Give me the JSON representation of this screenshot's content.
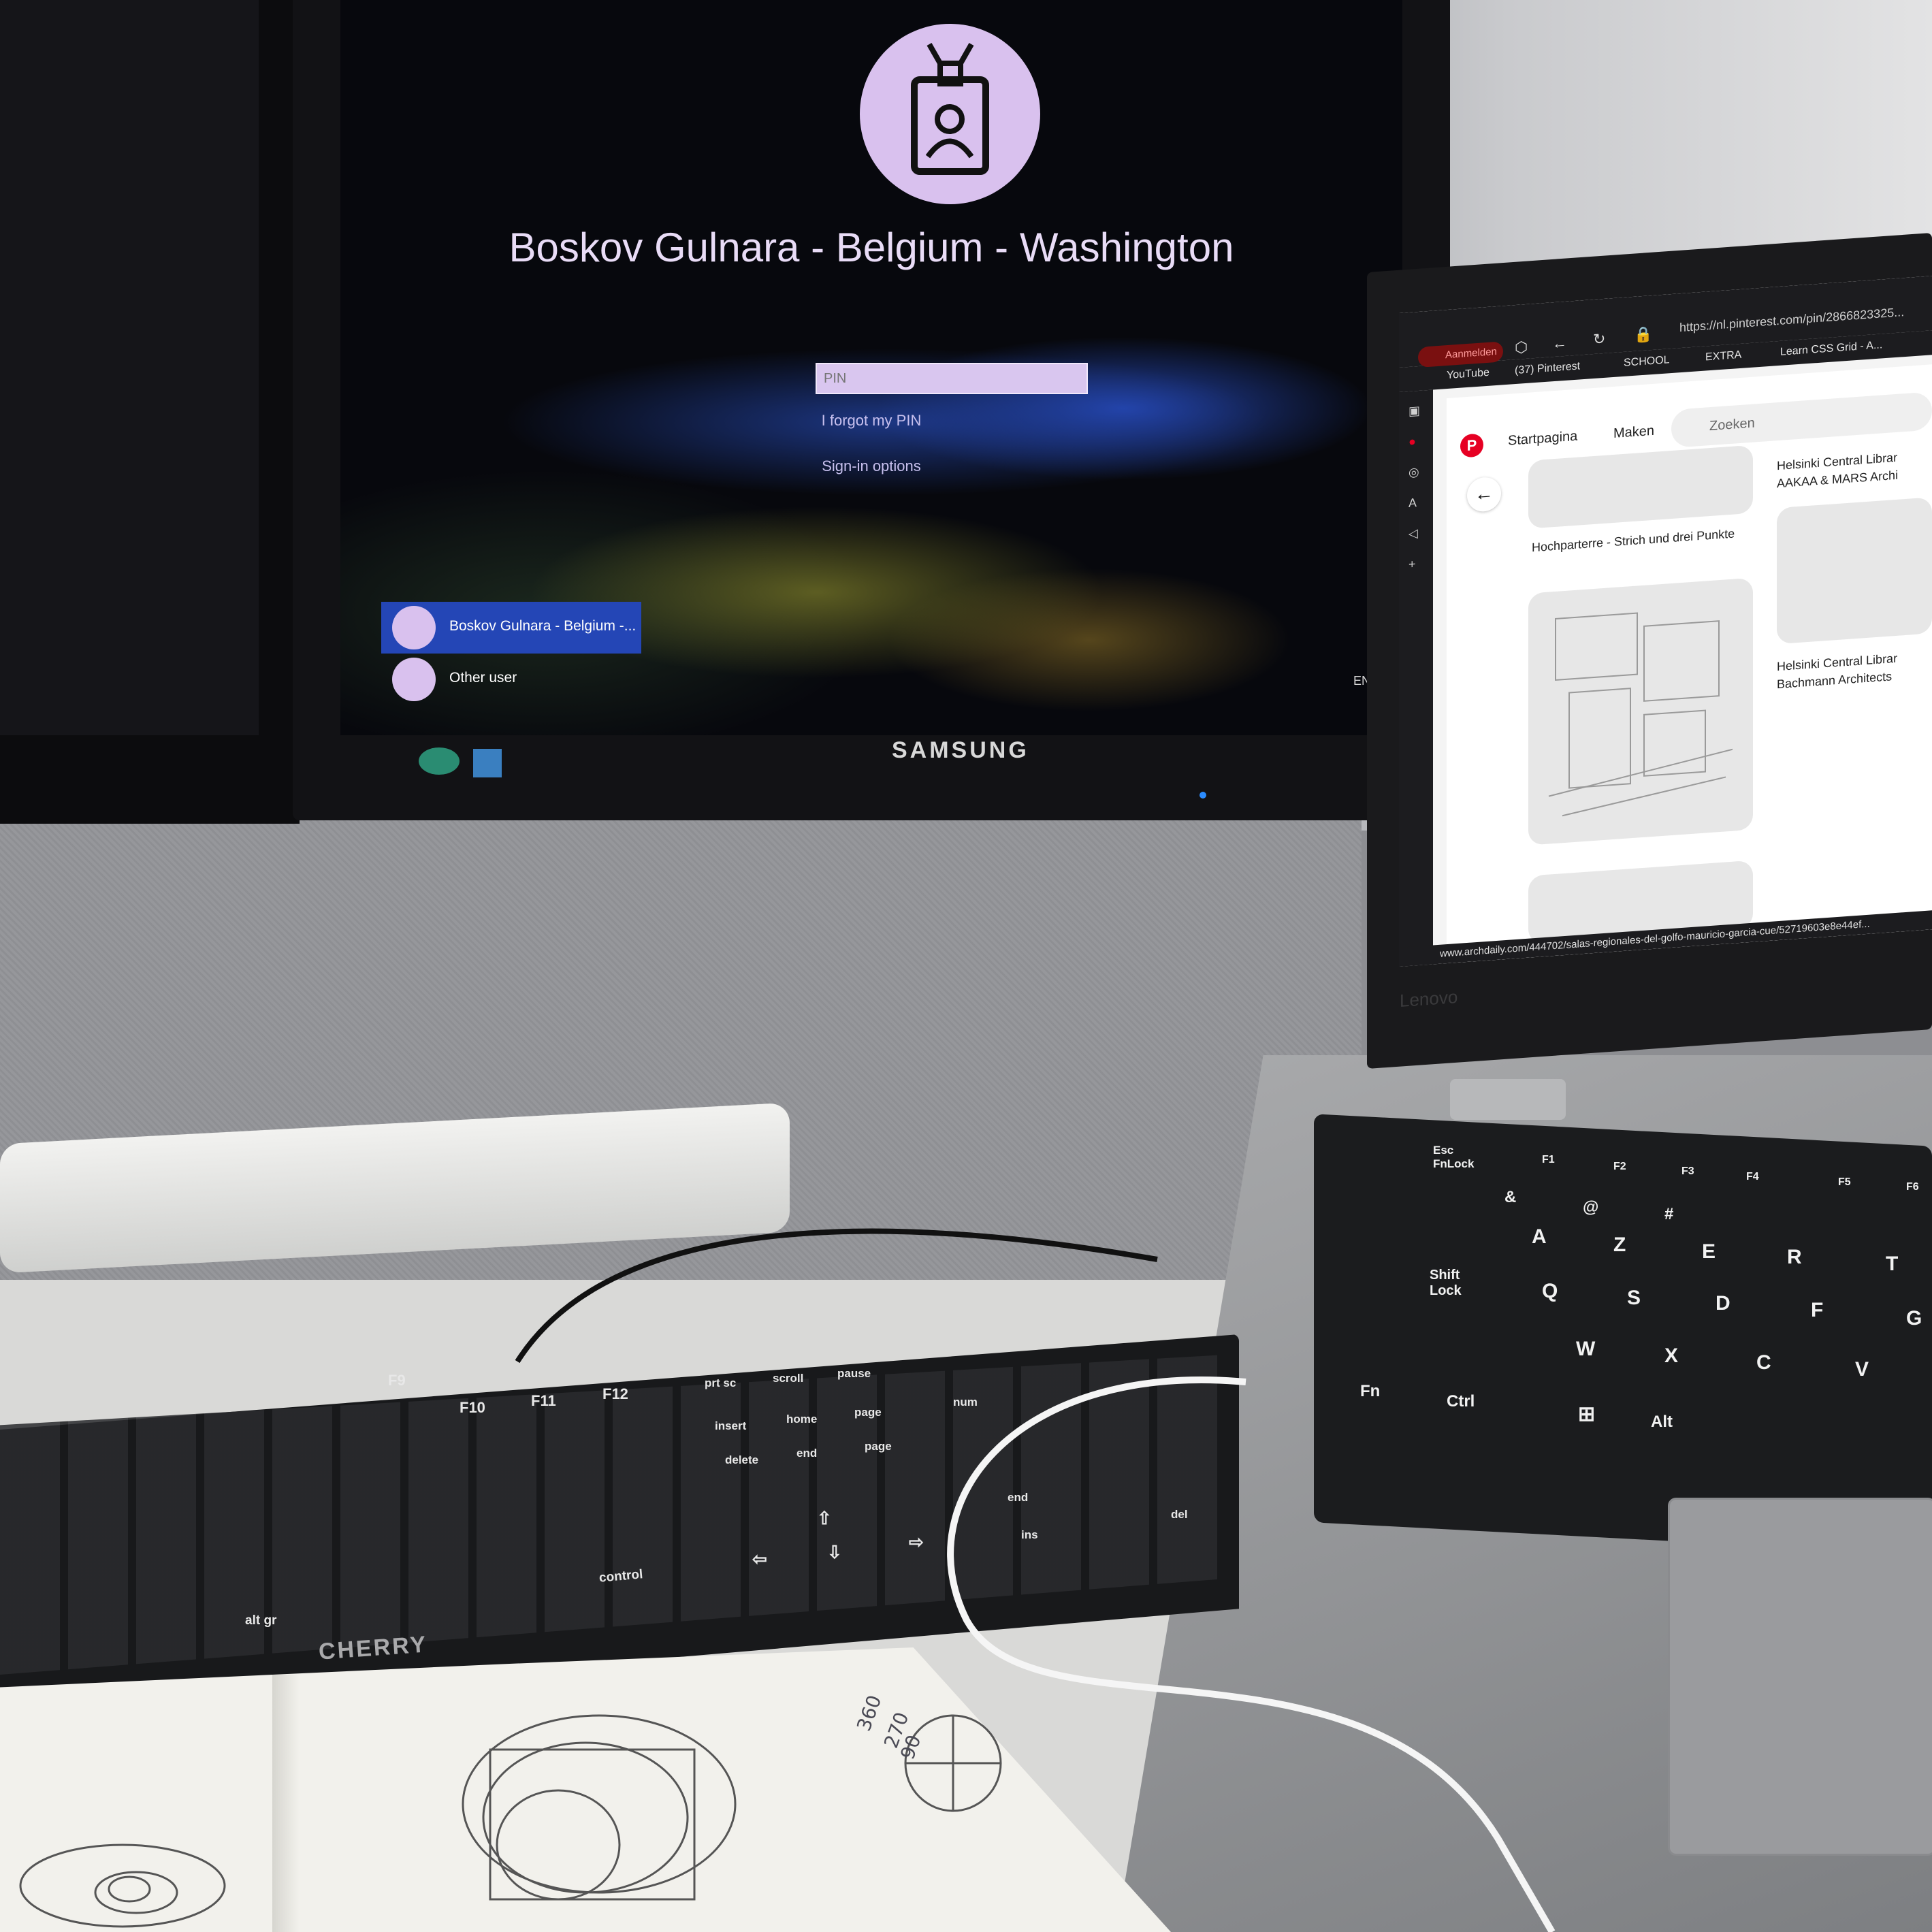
{
  "lock_screen": {
    "user_name": "Boskov Gulnara - Belgium - Washington",
    "pin_placeholder": "PIN",
    "forgot_pin": "I forgot my PIN",
    "sign_in_options": "Sign-in options",
    "users": [
      {
        "label": "Boskov Gulnara - Belgium -...",
        "selected": true
      },
      {
        "label": "Other user",
        "selected": false
      }
    ],
    "language": "EN",
    "accent_color": "#2446b6",
    "avatar_color": "#d9c1ee"
  },
  "monitor": {
    "brand": "SAMSUNG"
  },
  "browser": {
    "profile_button": "Aanmelden",
    "url": "https://nl.pinterest.com/pin/2866823325...",
    "bookmarks": [
      "YouTube",
      "(37) Pinterest",
      "SCHOOL",
      "EXTRA",
      "Learn CSS Grid - A..."
    ],
    "status_url": "www.archdaily.com/444702/salas-regionales-del-golfo-mauricio-garcia-cue/52719603e8e44ef..."
  },
  "pinterest": {
    "nav": [
      "Startpagina",
      "Maken"
    ],
    "search_placeholder": "Zoeken",
    "pins": [
      {
        "title": "Hochparterre - Strich und drei Punkte"
      },
      {
        "title": "Helsinki Central Librar AAKAA & MARS Archi"
      },
      {
        "title": "Helsinki Central Librar Bachmann Architects"
      }
    ],
    "brand_color": "#e60023"
  },
  "laptop": {
    "brand": "Lenovo",
    "keys": [
      "Esc FnLock",
      "F1",
      "F2",
      "F3",
      "F4",
      "F5",
      "F6",
      "&",
      "@",
      "#",
      "A",
      "Z",
      "E",
      "R",
      "T",
      "Shift Lock",
      "Q",
      "S",
      "D",
      "F",
      "G",
      "W",
      "X",
      "C",
      "V",
      "Fn",
      "Ctrl",
      "Alt"
    ]
  },
  "keyboard": {
    "brand": "CHERRY",
    "keys": [
      "F9",
      "F10",
      "F11",
      "F12",
      "prt sc",
      "scroll",
      "pause",
      "insert",
      "home",
      "page",
      "delete",
      "end",
      "page",
      "num",
      "control",
      "alt gr",
      "ins",
      "del",
      "end"
    ]
  },
  "notebook": {
    "numbers": [
      "360",
      "270",
      "90"
    ]
  }
}
